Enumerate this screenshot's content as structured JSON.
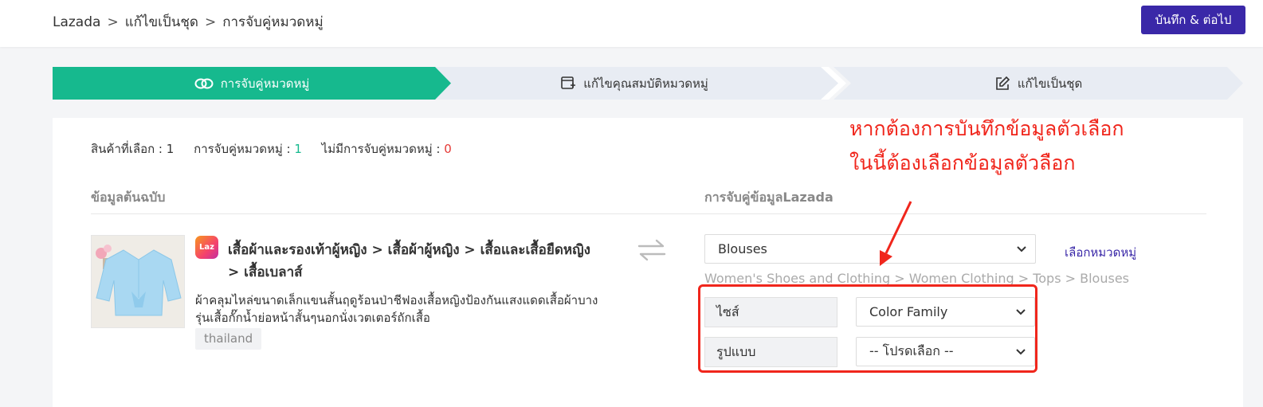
{
  "breadcrumb": {
    "items": [
      "Lazada",
      "แก้ไขเป็นชุด",
      "การจับคู่หมวดหมู่"
    ],
    "separator": ">"
  },
  "header": {
    "save_label": "บันทึก & ต่อไป"
  },
  "steps": [
    {
      "label": "การจับคู่หมวดหมู่",
      "icon": "link-icon",
      "active": true
    },
    {
      "label": "แก้ไขคุณสมบัติหมวดหมู่",
      "icon": "add-box-icon",
      "active": false
    },
    {
      "label": "แก้ไขเป็นชุด",
      "icon": "edit-icon",
      "active": false
    }
  ],
  "stats": {
    "selected_label": "สินค้าที่เลือก :",
    "selected_value": "1",
    "matched_label": "การจับคู่หมวดหมู่ :",
    "matched_value": "1",
    "unmatched_label": "ไม่มีการจับคู่หมวดหมู่ :",
    "unmatched_value": "0"
  },
  "annotation": {
    "line1": "หากต้องการบันทึกข้อมูลตัวเลือก",
    "line2": "ในนี้ต้องเลือกข้อมูลตัวลือก"
  },
  "columns": {
    "left_header": "ข้อมูลต้นฉบับ",
    "right_header": "การจับคู่ข้อมูลLazada"
  },
  "product": {
    "platform_logo_text": "Laz",
    "category_path": "เสื้อผ้าและรองเท้าผู้หญิง > เสื้อผ้าผู้หญิง > เสื้อและเสื้อยืดหญิง > เสื้อเบลาส์",
    "description": "ผ้าคลุมไหล่ขนาดเล็กแขนสั้นฤดูร้อนป่าชีฟองเสื้อหญิงป้องกันแสงแดดเสื้อผ้าบางรุ่นเสื้อกั๊กน้ำย่อหน้าสั้นๆนอกนั่งเวตเตอร์ถักเสื้อ",
    "tag": "thailand"
  },
  "mapping": {
    "category_value": "Blouses",
    "choose_category_label": "เลือกหมวดหมู่",
    "category_breadcrumb": "Women's Shoes and Clothing > Women Clothing > Tops > Blouses",
    "attributes": [
      {
        "label": "ไซส์",
        "value": "Color Family"
      },
      {
        "label": "รูปแบบ",
        "value": "-- โปรดเลือก --"
      }
    ]
  },
  "colors": {
    "accent": "#3a28a8",
    "step_active": "#16b98e",
    "annotation_red": "#f0261c"
  }
}
